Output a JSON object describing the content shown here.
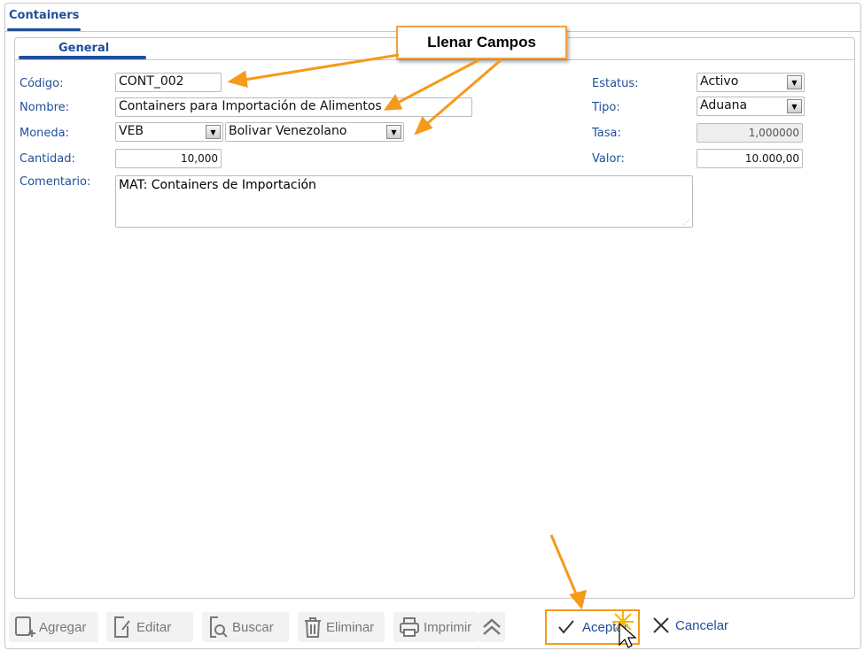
{
  "window": {
    "tab": "Containers",
    "subtab": "General"
  },
  "callout": "Llenar Campos",
  "form": {
    "codigo": {
      "label": "Código:",
      "value": "CONT_002"
    },
    "nombre": {
      "label": "Nombre:",
      "value": "Containers para Importación de Alimentos"
    },
    "moneda": {
      "label": "Moneda:",
      "code": "VEB",
      "name": "Bolivar Venezolano"
    },
    "cantidad": {
      "label": "Cantidad:",
      "value": "10,000"
    },
    "comentario": {
      "label": "Comentario:",
      "value": "MAT: Containers de Importación"
    },
    "estatus": {
      "label": "Estatus:",
      "value": "Activo"
    },
    "tipo": {
      "label": "Tipo:",
      "value": "Aduana"
    },
    "tasa": {
      "label": "Tasa:",
      "value": "1,000000"
    },
    "valor": {
      "label": "Valor:",
      "value": "10.000,00"
    }
  },
  "toolbar": {
    "agregar": "Agregar",
    "editar": "Editar",
    "buscar": "Buscar",
    "eliminar": "Eliminar",
    "imprimir": "Imprimir",
    "aceptar": "Aceptar",
    "cancelar": "Cancelar"
  },
  "colors": {
    "accent": "#1f4f9a",
    "highlight": "#f59a1a"
  }
}
